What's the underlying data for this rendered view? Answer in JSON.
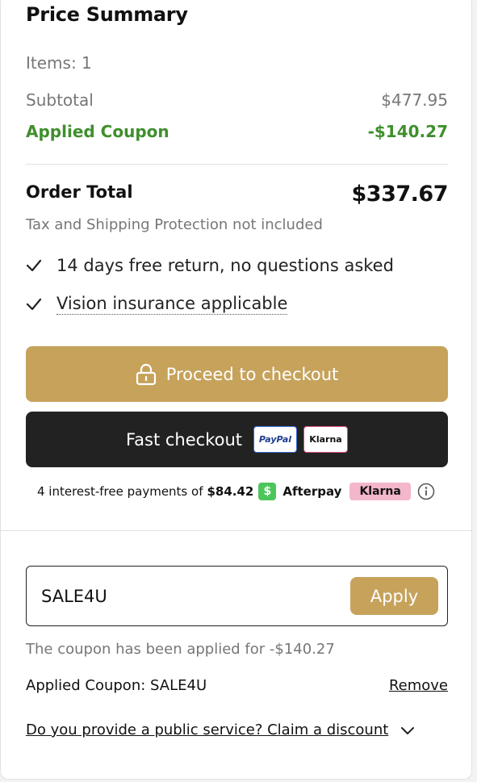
{
  "summary": {
    "title": "Price Summary",
    "items_label": "Items: 1",
    "subtotal_label": "Subtotal",
    "subtotal_value": "$477.95",
    "coupon_label": "Applied Coupon",
    "coupon_value": "-$140.27",
    "order_total_label": "Order Total",
    "order_total_value": "$337.67",
    "tax_note": "Tax and Shipping Protection not included",
    "features": [
      "14 days free return, no questions asked",
      "Vision insurance applicable"
    ]
  },
  "checkout": {
    "proceed_label": "Proceed to checkout",
    "fast_label": "Fast checkout",
    "paypal_badge": "PayPal",
    "klarna_badge": "Klarna"
  },
  "installments": {
    "text": "4 interest-free payments of",
    "amount": "$84.42",
    "afterpay_icon": "$",
    "afterpay_label": "Afterpay",
    "klarna_label": "Klarna"
  },
  "coupon": {
    "input_value": "SALE4U",
    "apply_label": "Apply",
    "message": "The coupon has been applied for -$140.27",
    "applied_text": "Applied Coupon: SALE4U",
    "remove_label": "Remove",
    "claim_text": "Do you provide a public service? Claim a discount"
  },
  "colors": {
    "accent_gold": "#c6a25b",
    "coupon_green": "#3f8f2d",
    "dark_button": "#222222",
    "klarna_pink": "#f3b6cb",
    "afterpay_green": "#4cc65b"
  }
}
